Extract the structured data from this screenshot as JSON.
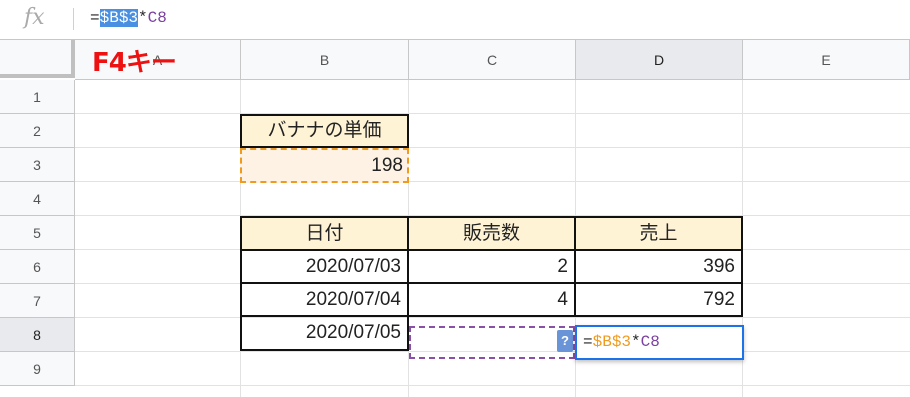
{
  "formula_bar": {
    "fx_label": "fx",
    "formula_prefix": "=",
    "formula_selected_ref": "$B$3",
    "formula_operator": "*",
    "formula_ref2": "C8"
  },
  "annotation": {
    "label": "F4キー"
  },
  "columns": [
    "A",
    "B",
    "C",
    "D",
    "E"
  ],
  "rows": [
    "1",
    "2",
    "3",
    "4",
    "5",
    "6",
    "7",
    "8",
    "9"
  ],
  "cells": {
    "b2": "バナナの単価",
    "b3": "198",
    "b5": "日付",
    "c5": "販売数",
    "d5": "売上",
    "b6": "2020/07/03",
    "c6": "2",
    "d6": "396",
    "b7": "2020/07/04",
    "c7": "4",
    "d7": "792",
    "b8": "2020/07/05",
    "c8": ""
  },
  "active_cell_formula": {
    "prefix": "=",
    "ref1": "$B$3",
    "operator": "*",
    "ref2": "C8"
  },
  "help_chip": "?",
  "colors": {
    "header_fill": "#fff3d6",
    "ref_orange": "#f09b1e",
    "ref_purple": "#7a3fa0",
    "selection_blue": "#4a90e2",
    "active_border": "#1a73e8",
    "annotation_red": "#ee1111"
  }
}
